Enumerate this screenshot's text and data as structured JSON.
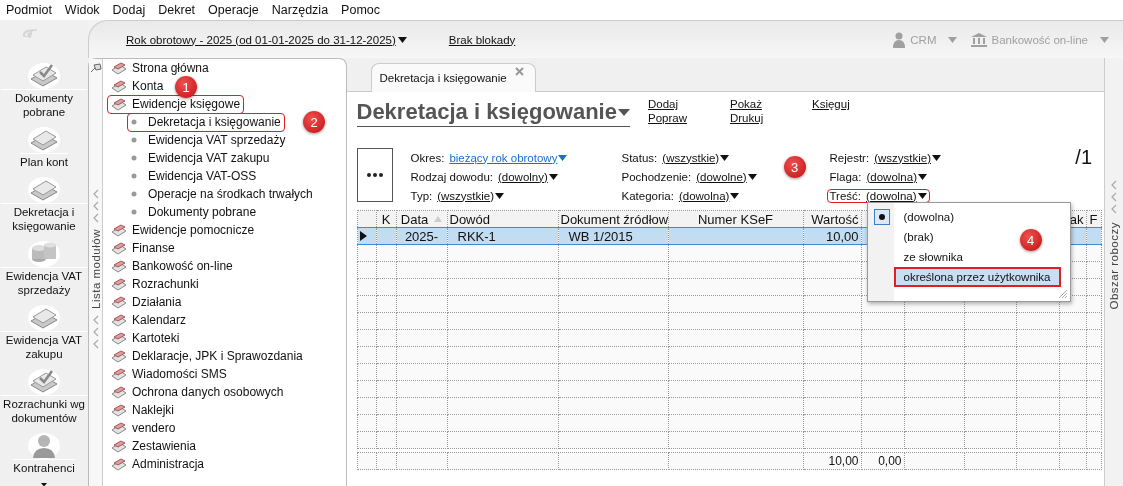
{
  "menu": [
    "Podmiot",
    "Widok",
    "Dodaj",
    "Dekret",
    "Operacje",
    "Narzędzia",
    "Pomoc"
  ],
  "toolbar": [
    {
      "label": "Dokumenty pobrane",
      "kind": "download"
    },
    {
      "label": "Plan kont",
      "kind": "blocks"
    },
    {
      "label": "Dekretacja i księgowanie",
      "kind": "pencil"
    },
    {
      "label": "Ewidencja VAT sprzedaży",
      "kind": "coins"
    },
    {
      "label": "Ewidencja VAT zakupu",
      "kind": "binders"
    },
    {
      "label": "Rozrachunki wg dokumentów",
      "kind": "check"
    },
    {
      "label": "Kontrahenci",
      "kind": "person"
    }
  ],
  "header": {
    "period": "Rok obrotowy - 2025  (od 01-01-2025 do 31-12-2025)",
    "lock": "Brak blokady",
    "crm": {
      "label": "CRM",
      "disabled": true
    },
    "bank": {
      "label": "Bankowość on-line",
      "disabled": true
    }
  },
  "modules": {
    "title": "Lista modułów",
    "items": [
      {
        "label": "Strona główna"
      },
      {
        "label": "Konta",
        "callout": "1"
      },
      {
        "label": "Ewidencje księgowe",
        "outlined": true,
        "expanded": true,
        "children": [
          {
            "label": "Dekretacja i księgowanie",
            "outlined": true,
            "callout": "2"
          },
          {
            "label": "Ewidencja VAT sprzedaży"
          },
          {
            "label": "Ewidencja VAT zakupu"
          },
          {
            "label": "Ewidencja VAT-OSS"
          },
          {
            "label": "Operacje na środkach trwałych"
          },
          {
            "label": "Dokumenty pobrane"
          }
        ]
      },
      {
        "label": "Ewidencje pomocnicze"
      },
      {
        "label": "Finanse"
      },
      {
        "label": "Bankowość on-line"
      },
      {
        "label": "Rozrachunki"
      },
      {
        "label": "Działania"
      },
      {
        "label": "Kalendarz"
      },
      {
        "label": "Kartoteki"
      },
      {
        "label": "Deklaracje, JPK i Sprawozdania"
      },
      {
        "label": "Wiadomości SMS"
      },
      {
        "label": "Ochrona danych osobowych"
      },
      {
        "label": "Naklejki"
      },
      {
        "label": "vendero"
      },
      {
        "label": "Zestawienia"
      },
      {
        "label": "Administracja"
      }
    ]
  },
  "tab": {
    "label": "Dekretacja i księgowanie"
  },
  "title": "Dekretacja i księgowanie",
  "actions": [
    [
      "Dodaj",
      "Popraw"
    ],
    [
      "Pokaż",
      "Drukuj"
    ],
    [
      "Księguj"
    ]
  ],
  "filters": [
    [
      {
        "label": "Okres:",
        "value": "bieżący rok obrotowy",
        "accent": true
      },
      {
        "label": "Rodzaj dowodu:",
        "value": "(dowolny)"
      },
      {
        "label": "Typ:",
        "value": "(wszystkie)"
      }
    ],
    [
      {
        "label": "Status:",
        "value": "(wszystkie)"
      },
      {
        "label": "Pochodzenie:",
        "value": "(dowolne)"
      },
      {
        "label": "Kategoria:",
        "value": "(dowolna)"
      }
    ],
    [
      {
        "label": "Rejestr:",
        "value": "(wszystkie)"
      },
      {
        "label": "Flaga:",
        "value": "(dowolna)"
      },
      {
        "label": "Treść:",
        "value": "(dowolna)",
        "outlined": true,
        "callout": "3"
      }
    ]
  ],
  "page": "/1",
  "dropdown": {
    "options": [
      {
        "label": "(dowolna)",
        "selected": true
      },
      {
        "label": "(brak)",
        "selected": false
      },
      {
        "label": "ze słownika",
        "selected": false
      },
      {
        "label": "określona przez użytkownika",
        "selected": false,
        "hovered": true,
        "outlined": true,
        "callout": "4"
      }
    ]
  },
  "table": {
    "columns": [
      {
        "label": "K",
        "sorted": false
      },
      {
        "label": "Data",
        "sorted": true
      },
      {
        "label": "Dowód",
        "sorted": false
      },
      {
        "label": "Dokument źródłow",
        "sorted": false
      },
      {
        "label": "Numer KSeF",
        "sorted": false
      },
      {
        "label": "Wartość",
        "sorted": false
      },
      {},
      {},
      {},
      {},
      {
        "label": "ak",
        "sorted": false
      },
      {
        "label": "F",
        "sorted": false
      }
    ],
    "rows": [
      {
        "kind": "entry",
        "selected": true,
        "cells": [
          null,
          "2025-",
          "RKK-1",
          "WB 1/2015",
          null,
          "10,00",
          null,
          null,
          null,
          null,
          null,
          null
        ]
      },
      {
        "kind": "totals",
        "selected": false,
        "cells": [
          null,
          null,
          null,
          null,
          null,
          "10,00",
          "0,00",
          null,
          null,
          null,
          null,
          null
        ]
      }
    ]
  },
  "workspace": "Obszar roboczy"
}
